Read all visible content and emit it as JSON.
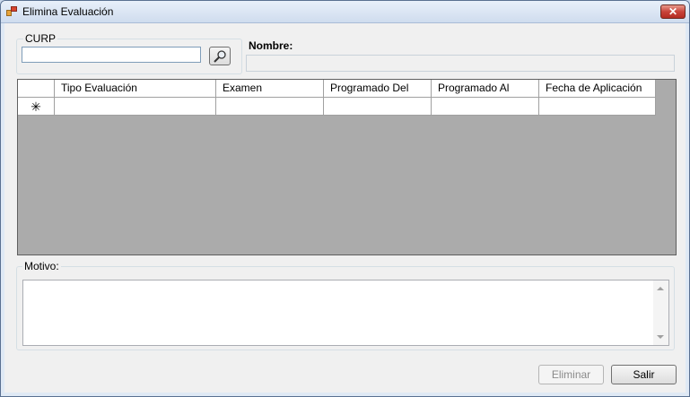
{
  "window": {
    "title": "Elimina Evaluación",
    "close_glyph": "✕",
    "icon": "app-icon"
  },
  "curp": {
    "legend": "CURP",
    "value": "",
    "search_icon": "search-icon"
  },
  "nombre": {
    "label": "Nombre:",
    "value": ""
  },
  "grid": {
    "columns": [
      "Tipo Evaluación",
      "Examen",
      "Programado Del",
      "Programado Al",
      "Fecha de Aplicación"
    ],
    "new_row_glyph": "✳"
  },
  "motivo": {
    "legend": "Motivo:",
    "value": ""
  },
  "buttons": {
    "eliminar": "Eliminar",
    "salir": "Salir"
  }
}
